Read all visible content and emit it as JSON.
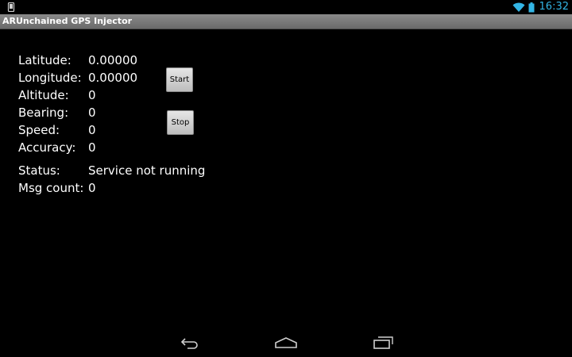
{
  "status_bar": {
    "time": "16:32",
    "icons": [
      "notification-icon",
      "wifi-icon",
      "battery-icon"
    ],
    "accent_color": "#33b5e5"
  },
  "app": {
    "title": "ARUnchained GPS Injector"
  },
  "fields": {
    "latitude": {
      "label": "Latitude:",
      "value": "0.00000"
    },
    "longitude": {
      "label": "Longitude:",
      "value": "0.00000"
    },
    "altitude": {
      "label": "Altitude:",
      "value": "0"
    },
    "bearing": {
      "label": "Bearing:",
      "value": "0"
    },
    "speed": {
      "label": "Speed:",
      "value": "0"
    },
    "accuracy": {
      "label": "Accuracy:",
      "value": "0"
    },
    "status": {
      "label": "Status:",
      "value": "Service not running"
    },
    "msg_count": {
      "label": "Msg count:",
      "value": "0"
    }
  },
  "buttons": {
    "start": "Start",
    "stop": "Stop"
  },
  "nav_bar": {
    "icons": [
      "back-icon",
      "home-icon",
      "recent-apps-icon"
    ]
  }
}
